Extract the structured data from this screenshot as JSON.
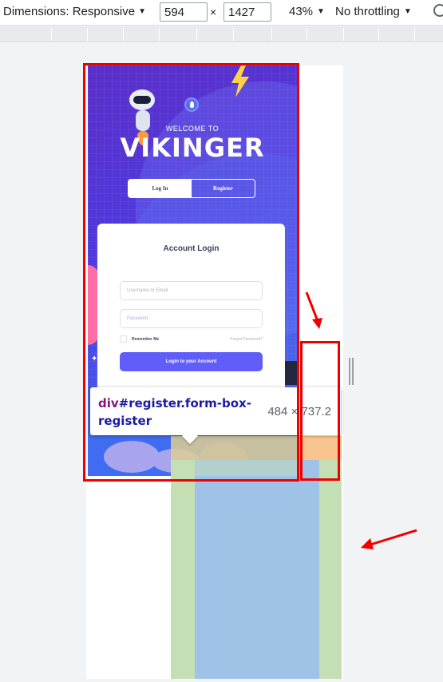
{
  "devtools": {
    "dimensions_label": "Dimensions: Responsive",
    "width_value": "594",
    "height_value": "1427",
    "times_sign": "×",
    "zoom": "43%",
    "throttling": "No throttling"
  },
  "page": {
    "welcome": "WELCOME TO",
    "brand": "VIKINGER",
    "tab_login": "Log In",
    "tab_register": "Register",
    "card_title": "Account Login",
    "username_placeholder": "Username or Email",
    "password_placeholder": "Password",
    "remember_label": "Remember Me",
    "forgot_label": "Forgot Password?",
    "login_button": "Login to your Account"
  },
  "inspect_tooltip": {
    "tag": "div",
    "selector": "#register.form-box-register",
    "size": "484 × 737.2"
  },
  "colors": {
    "accent": "#615dfa",
    "highlight_red": "#ee0000"
  }
}
